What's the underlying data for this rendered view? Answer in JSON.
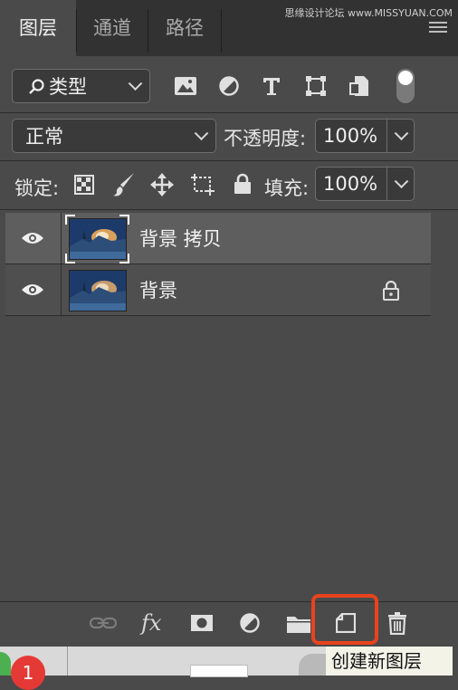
{
  "watermark": "思缘设计论坛 www.MISSYUAN.COM",
  "tabs": [
    {
      "label": "图层",
      "active": true
    },
    {
      "label": "通道",
      "active": false
    },
    {
      "label": "路径",
      "active": false
    }
  ],
  "filter": {
    "dropdown_value": "类型",
    "icons": [
      "image-filter-icon",
      "adjustment-filter-icon",
      "type-filter-icon",
      "shape-filter-icon",
      "smart-object-filter-icon",
      "filter-toggle-icon"
    ]
  },
  "blend": {
    "mode": "正常",
    "opacity_label": "不透明度:",
    "opacity_value": "100%"
  },
  "lock": {
    "label": "锁定:",
    "fill_label": "填充:",
    "fill_value": "100%"
  },
  "layers": [
    {
      "name": "背景 拷贝",
      "visible": true,
      "selected": true,
      "locked": false
    },
    {
      "name": "背景",
      "visible": true,
      "selected": false,
      "locked": true
    }
  ],
  "bottom_tools": [
    "link-layers-icon",
    "fx-icon",
    "mask-icon",
    "adjustment-icon",
    "folder-icon",
    "new-layer-icon",
    "trash-icon"
  ],
  "fx_label": "fx",
  "tooltip": "创建新图层",
  "dock": {
    "badge": "1"
  },
  "colors": {
    "highlight": "#e8431d",
    "panel": "#4a4a4a",
    "tabbar": "#323232"
  }
}
